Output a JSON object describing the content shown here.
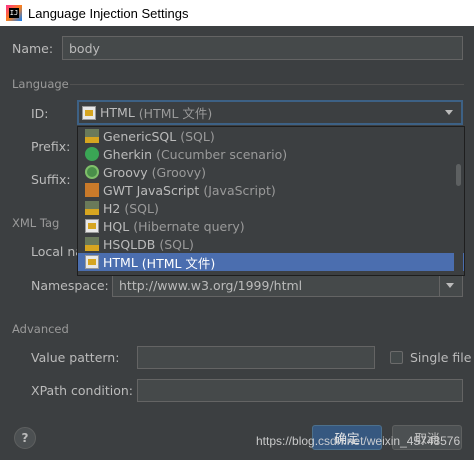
{
  "window": {
    "title": "Language Injection Settings",
    "app_icon_label": "IJ"
  },
  "name": {
    "label": "Name:",
    "value": "body"
  },
  "language_section": {
    "title": "Language",
    "id_label": "ID:",
    "id_value": "HTML",
    "id_value_sub": "(HTML 文件)",
    "prefix_label": "Prefix:",
    "suffix_label": "Suffix:"
  },
  "dropdown": {
    "items": [
      {
        "name": "GenericSQL",
        "sub": "(SQL)",
        "icon": "sql-icon",
        "selected": false
      },
      {
        "name": "Gherkin",
        "sub": "(Cucumber scenario)",
        "icon": "gherkin-icon",
        "selected": false
      },
      {
        "name": "Groovy",
        "sub": "(Groovy)",
        "icon": "groovy-icon",
        "selected": false
      },
      {
        "name": "GWT JavaScript",
        "sub": "(JavaScript)",
        "icon": "gwt-icon",
        "selected": false
      },
      {
        "name": "H2",
        "sub": "(SQL)",
        "icon": "sql-icon",
        "selected": false
      },
      {
        "name": "HQL",
        "sub": "(Hibernate query)",
        "icon": "hql-icon",
        "selected": false
      },
      {
        "name": "HSQLDB",
        "sub": "(SQL)",
        "icon": "sql-icon",
        "selected": false
      },
      {
        "name": "HTML",
        "sub": "(HTML 文件)",
        "icon": "html-icon",
        "selected": true
      }
    ]
  },
  "xml_section": {
    "title": "XML Tag",
    "local_name_label": "Local na",
    "namespace_label": "Namespace:",
    "namespace_value": "http://www.w3.org/1999/html"
  },
  "advanced_section": {
    "title": "Advanced",
    "value_pattern_label": "Value pattern:",
    "single_file_label": "Single file",
    "xpath_label": "XPath condition:"
  },
  "buttons": {
    "help": "?",
    "ok": "确定",
    "cancel": "取消"
  },
  "watermark": "https://blog.csdn.net/weixin_45748576",
  "colors": {
    "background": "#3c3f41",
    "selection": "#4b6eaf",
    "focus_border": "#3d6185"
  }
}
